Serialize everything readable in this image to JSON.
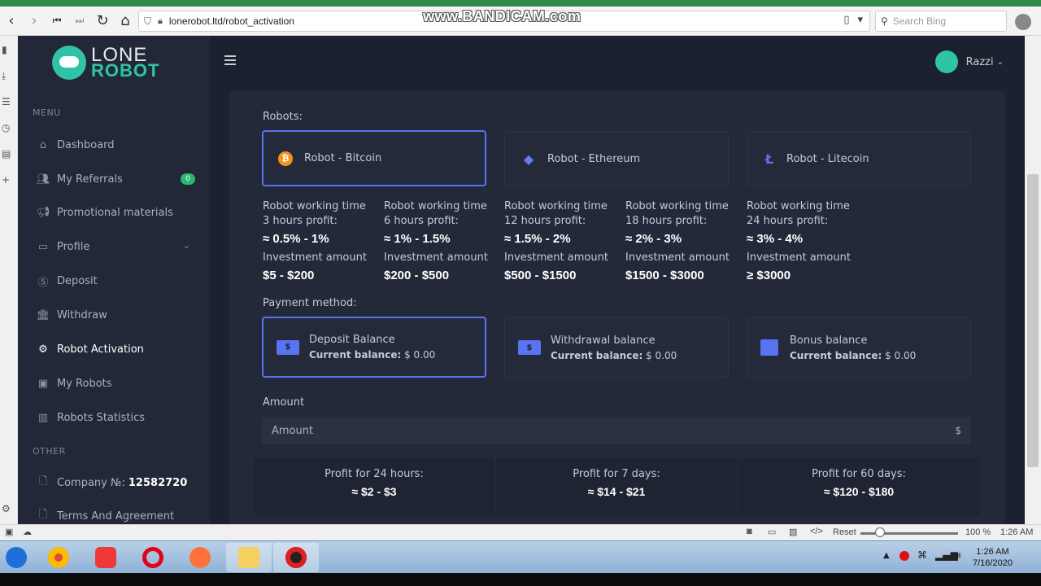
{
  "browser": {
    "url": "lonerobot.ltd/robot_activation",
    "search_placeholder": "Search Bing",
    "watermark": "www.BANDICAM.com",
    "zoom": "100 %",
    "reset_label": "Reset",
    "status_time": "1:26 AM"
  },
  "sidebar": {
    "logo_line1": "LONE",
    "logo_line2": "ROBOT",
    "menu_label": "MENU",
    "items": [
      {
        "label": "Dashboard",
        "icon": "home-icon"
      },
      {
        "label": "My Referrals",
        "icon": "users-icon",
        "badge": "0"
      },
      {
        "label": "Promotional materials",
        "icon": "megaphone-icon"
      },
      {
        "label": "Profile",
        "icon": "profile-card-icon"
      },
      {
        "label": "Deposit",
        "icon": "dollar-circle-icon"
      },
      {
        "label": "Withdraw",
        "icon": "bank-icon"
      },
      {
        "label": "Robot Activation",
        "icon": "robot-gear-icon",
        "active": true
      },
      {
        "label": "My Robots",
        "icon": "robot-icon"
      },
      {
        "label": "Robots Statistics",
        "icon": "bar-chart-icon"
      }
    ],
    "other_label": "OTHER",
    "company_label": "Company №:",
    "company_number": "12582720",
    "terms_label": "Terms And Agreement"
  },
  "header": {
    "username": "Razzi"
  },
  "main": {
    "robots_label": "Robots:",
    "robots": [
      {
        "name": "Robot - Bitcoin",
        "icon": "bitcoin-icon",
        "color": "#f7931a",
        "selected": true
      },
      {
        "name": "Robot - Ethereum",
        "icon": "ethereum-icon",
        "color": "#627eea",
        "selected": false
      },
      {
        "name": "Robot - Litecoin",
        "icon": "litecoin-icon",
        "color": "#5a73f0",
        "selected": false
      }
    ],
    "tiers": [
      {
        "time_label": "Robot working time",
        "hours_label": "3 hours profit:",
        "profit": "≈ 0.5% - 1%",
        "invest_label": "Investment amount",
        "invest": "$5 - $200"
      },
      {
        "time_label": "Robot working time",
        "hours_label": "6 hours profit:",
        "profit": "≈ 1% - 1.5%",
        "invest_label": "Investment amount",
        "invest": "$200 - $500"
      },
      {
        "time_label": "Robot working time",
        "hours_label": "12 hours profit:",
        "profit": "≈ 1.5% - 2%",
        "invest_label": "Investment amount",
        "invest": "$500 - $1500"
      },
      {
        "time_label": "Robot working time",
        "hours_label": "18 hours profit:",
        "profit": "≈ 2% - 3%",
        "invest_label": "Investment amount",
        "invest": "$1500 - $3000"
      },
      {
        "time_label": "Robot working time",
        "hours_label": "24 hours profit:",
        "profit": "≈ 3% - 4%",
        "invest_label": "Investment amount",
        "invest": "≥ $3000"
      }
    ],
    "payment_label": "Payment method:",
    "payments": [
      {
        "name": "Deposit Balance",
        "balance_label": "Current balance:",
        "balance": "$ 0.00",
        "icon": "cash-icon",
        "selected": true
      },
      {
        "name": "Withdrawal balance",
        "balance_label": "Current balance:",
        "balance": "$ 0.00",
        "icon": "cash-icon",
        "selected": false
      },
      {
        "name": "Bonus balance",
        "balance_label": "Current balance:",
        "balance": "$ 0.00",
        "icon": "wallet-icon",
        "selected": false
      }
    ],
    "amount_label": "Amount",
    "amount_placeholder": "Amount",
    "amount_currency": "$",
    "profits": [
      {
        "label": "Profit for 24 hours:",
        "value": "≈ $2 - $3"
      },
      {
        "label": "Profit for 7 days:",
        "value": "≈ $14 - $21"
      },
      {
        "label": "Profit for 60 days:",
        "value": "≈ $120 - $180"
      }
    ]
  },
  "taskbar": {
    "clock_time": "1:26 AM",
    "clock_date": "7/16/2020"
  }
}
